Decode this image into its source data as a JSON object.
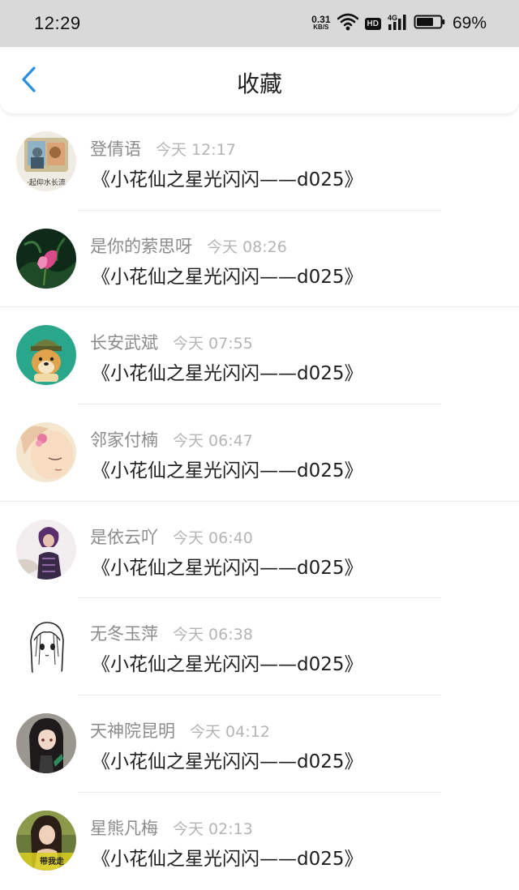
{
  "status_bar": {
    "time": "12:29",
    "net_speed_value": "0.31",
    "net_speed_unit": "KB/S",
    "hd_label": "HD",
    "network_label": "4G",
    "battery_percent": "69%"
  },
  "header": {
    "title": "收藏"
  },
  "items": [
    {
      "user": "登倩语",
      "time": "今天 12:17",
      "title": "《小花仙之星光闪闪——d025》"
    },
    {
      "user": "是你的萦思呀",
      "time": "今天 08:26",
      "title": "《小花仙之星光闪闪——d025》"
    },
    {
      "user": "长安武斌",
      "time": "今天 07:55",
      "title": "《小花仙之星光闪闪——d025》"
    },
    {
      "user": "邻家付楠",
      "time": "今天 06:47",
      "title": "《小花仙之星光闪闪——d025》"
    },
    {
      "user": "是依云吖",
      "time": "今天 06:40",
      "title": "《小花仙之星光闪闪——d025》"
    },
    {
      "user": "无冬玉萍",
      "time": "今天 06:38",
      "title": "《小花仙之星光闪闪——d025》"
    },
    {
      "user": "天神院昆明",
      "time": "今天 04:12",
      "title": "《小花仙之星光闪闪——d025》"
    },
    {
      "user": "星熊凡梅",
      "time": "今天 02:13",
      "title": "《小花仙之星光闪闪——d025》"
    }
  ],
  "avatar_texts": {
    "first": "·起仰水长流",
    "last": "带我走"
  },
  "colors": {
    "accent": "#2a8fdc",
    "status_bar_bg": "#d9d9d9",
    "username": "#8b8b8b",
    "time": "#b5b5b5"
  }
}
